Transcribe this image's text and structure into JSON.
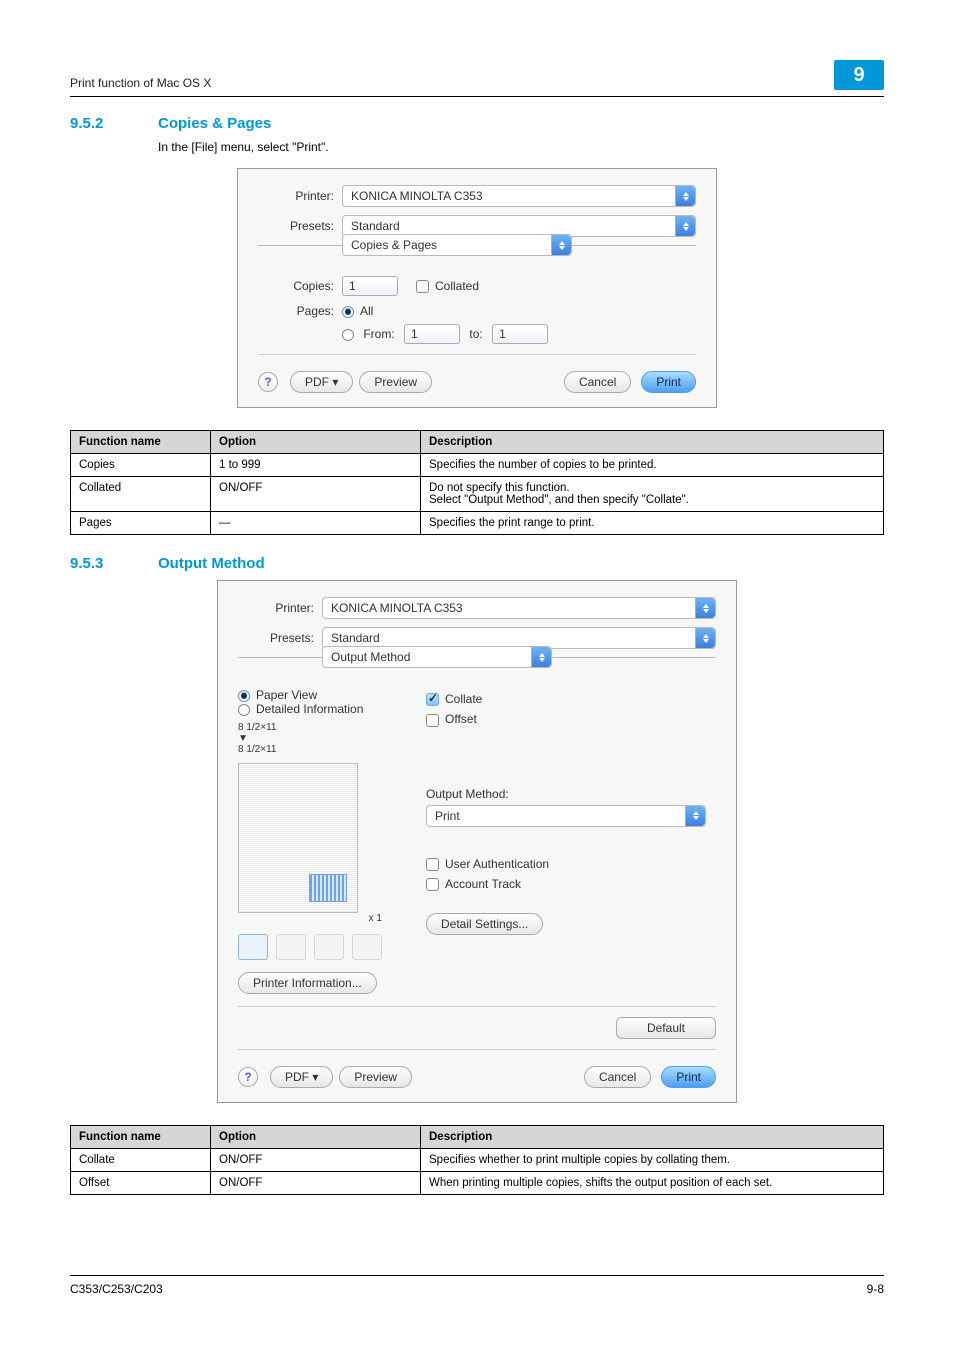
{
  "header": {
    "breadcrumb": "Print function of Mac OS X",
    "chapter_number": "9"
  },
  "sections": {
    "copies_pages": {
      "num": "9.5.2",
      "title": "Copies & Pages",
      "intro": "In the [File] menu, select \"Print\"."
    },
    "output_method": {
      "num": "9.5.3",
      "title": "Output Method"
    }
  },
  "dialog1": {
    "printer_label": "Printer:",
    "printer_value": "KONICA MINOLTA C353",
    "presets_label": "Presets:",
    "presets_value": "Standard",
    "panel_value": "Copies & Pages",
    "copies_label": "Copies:",
    "copies_value": "1",
    "collated_label": "Collated",
    "pages_label": "Pages:",
    "pages_all": "All",
    "pages_from": "From:",
    "from_value": "1",
    "pages_to": "to:",
    "to_value": "1",
    "help": "?",
    "pdf_btn": "PDF ▾",
    "preview_btn": "Preview",
    "cancel_btn": "Cancel",
    "print_btn": "Print"
  },
  "dialog2": {
    "printer_label": "Printer:",
    "printer_value": "KONICA MINOLTA C353",
    "presets_label": "Presets:",
    "presets_value": "Standard",
    "panel_value": "Output Method",
    "paper_view": "Paper View",
    "detailed_info": "Detailed Information",
    "size_top": "8 1/2×11",
    "size_arrow": "▼",
    "size_bottom": "8 1/2×11",
    "x1": "x 1",
    "collate": "Collate",
    "offset": "Offset",
    "output_method_label": "Output Method:",
    "output_method_value": "Print",
    "user_auth": "User Authentication",
    "account_track": "Account Track",
    "printer_info_btn": "Printer Information...",
    "detail_btn": "Detail Settings...",
    "default_btn": "Default",
    "help": "?",
    "pdf_btn": "PDF ▾",
    "preview_btn": "Preview",
    "cancel_btn": "Cancel",
    "print_btn": "Print"
  },
  "table1": {
    "headers": {
      "fn": "Function name",
      "opt": "Option",
      "desc": "Description"
    },
    "rows": [
      {
        "fn": "Copies",
        "opt": "1 to 999",
        "desc": "Specifies the number of copies to be printed."
      },
      {
        "fn": "Collated",
        "opt": "ON/OFF",
        "desc": "Do not specify this function.\nSelect \"Output Method\", and then specify \"Collate\"."
      },
      {
        "fn": "Pages",
        "opt": "—",
        "desc": "Specifies the print range to print."
      }
    ]
  },
  "table2": {
    "headers": {
      "fn": "Function name",
      "opt": "Option",
      "desc": "Description"
    },
    "rows": [
      {
        "fn": "Collate",
        "opt": "ON/OFF",
        "desc": "Specifies whether to print multiple copies by collating them."
      },
      {
        "fn": "Offset",
        "opt": "ON/OFF",
        "desc": "When printing multiple copies, shifts the output position of each set."
      }
    ]
  },
  "footer": {
    "left": "C353/C253/C203",
    "right": "9-8"
  }
}
